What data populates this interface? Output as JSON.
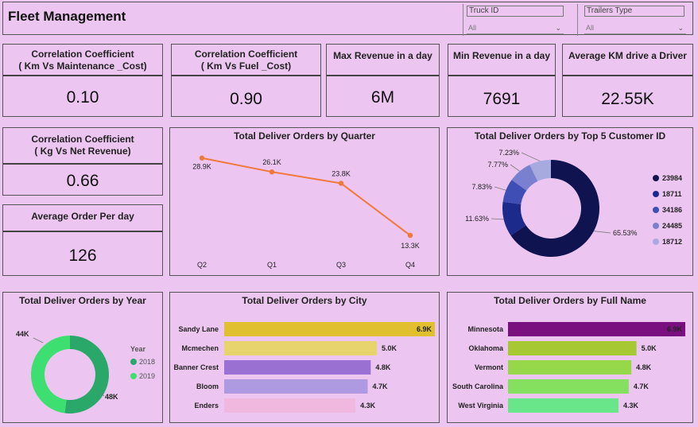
{
  "header": {
    "title": "Fleet Management",
    "slicers": [
      {
        "label": "Truck ID",
        "value": "All"
      },
      {
        "label": "Trailers Type",
        "value": "All"
      }
    ]
  },
  "cards": {
    "corr_km_maint": {
      "title_line1": "Correlation Coefficient",
      "title_line2": "( Km Vs Maintenance _Cost)",
      "value": "0.10"
    },
    "corr_km_fuel": {
      "title_line1": "Correlation Coefficient",
      "title_line2": "( Km Vs Fuel _Cost)",
      "value": "0.90"
    },
    "max_revenue": {
      "title": "Max Revenue in a day",
      "value": "6M"
    },
    "min_revenue": {
      "title": "Min Revenue in a day",
      "value": "7691"
    },
    "avg_km": {
      "title": "Average KM drive a Driver",
      "value": "22.55K"
    },
    "corr_kg_rev": {
      "title_line1": "Correlation Coefficient",
      "title_line2": "( Kg Vs Net Revenue)",
      "value": "0.66"
    },
    "avg_order": {
      "title": "Average Order Per day",
      "value": "126"
    }
  },
  "charts": {
    "quarter": {
      "title": "Total Deliver Orders by Quarter"
    },
    "customer": {
      "title": "Total Deliver Orders by Top 5 Customer ID"
    },
    "year": {
      "title": "Total Deliver Orders by Year",
      "legend_title": "Year"
    },
    "city": {
      "title": "Total Deliver Orders by City"
    },
    "fullname": {
      "title": "Total Deliver Orders by Full Name"
    }
  },
  "chart_data": [
    {
      "id": "quarter",
      "type": "line",
      "title": "Total Deliver Orders by Quarter",
      "categories": [
        "Q2",
        "Q1",
        "Q3",
        "Q4"
      ],
      "values": [
        28900,
        26100,
        23800,
        13300
      ],
      "labels": [
        "28.9K",
        "26.1K",
        "23.8K",
        "13.3K"
      ],
      "color": "#f07838"
    },
    {
      "id": "customer",
      "type": "pie",
      "title": "Total Deliver Orders by Top 5 Customer ID",
      "categories": [
        "23984",
        "18711",
        "34186",
        "24485",
        "18712"
      ],
      "values": [
        65.53,
        11.63,
        7.83,
        7.77,
        7.23
      ],
      "labels": [
        "65.53%",
        "11.63%",
        "7.83%",
        "7.77%",
        "7.23%"
      ],
      "colors": [
        "#0f1450",
        "#1c2a8c",
        "#3e4eb4",
        "#7a80d0",
        "#a6aade"
      ]
    },
    {
      "id": "year",
      "type": "pie",
      "title": "Total Deliver Orders by Year",
      "legend_title": "Year",
      "categories": [
        "2018",
        "2019"
      ],
      "values": [
        48000,
        44000
      ],
      "labels": [
        "48K",
        "44K"
      ],
      "colors": [
        "#2aa86a",
        "#3de070"
      ]
    },
    {
      "id": "city",
      "type": "bar",
      "title": "Total Deliver Orders by City",
      "categories": [
        "Sandy Lane",
        "Mcmechen",
        "Banner Crest",
        "Bloom",
        "Enders"
      ],
      "values": [
        6900,
        5000,
        4800,
        4700,
        4300
      ],
      "labels": [
        "6.9K",
        "5.0K",
        "4.8K",
        "4.7K",
        "4.3K"
      ],
      "colors": [
        "#e0c02e",
        "#e8d46c",
        "#9a70d2",
        "#ae9ae0",
        "#f0b8de"
      ]
    },
    {
      "id": "fullname",
      "type": "bar",
      "title": "Total Deliver Orders by Full Name",
      "categories": [
        "Minnesota",
        "Oklahoma",
        "Vermont",
        "South Carolina",
        "West Virginia"
      ],
      "values": [
        6900,
        5000,
        4800,
        4700,
        4300
      ],
      "labels": [
        "6.9K",
        "5.0K",
        "4.8K",
        "4.7K",
        "4.3K"
      ],
      "colors": [
        "#7a1080",
        "#a6c832",
        "#96d84a",
        "#86e060",
        "#6ae68a"
      ]
    }
  ]
}
